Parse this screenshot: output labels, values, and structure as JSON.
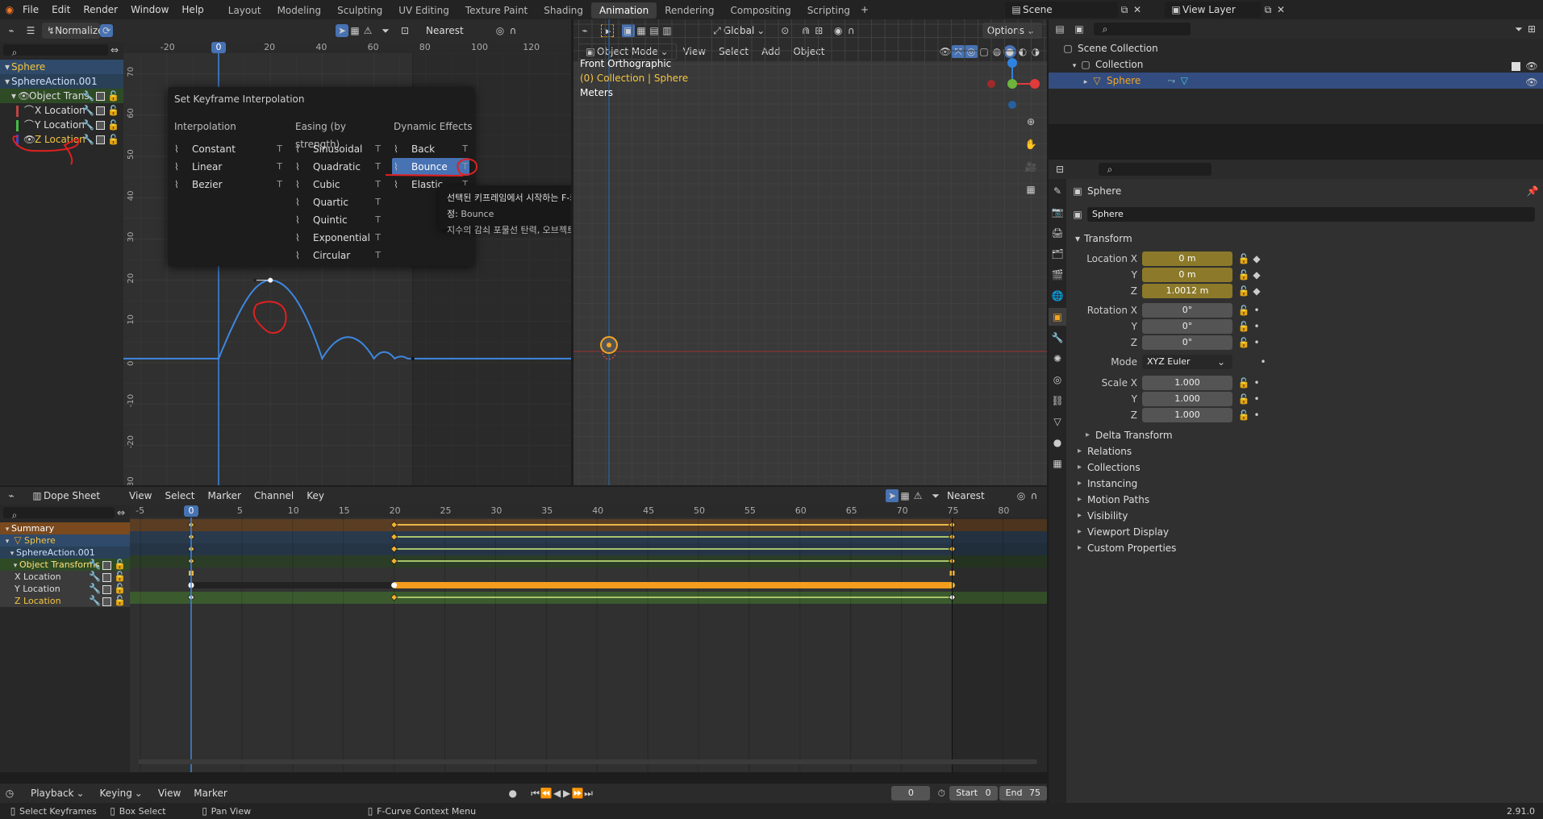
{
  "topbar": {
    "menus": [
      "File",
      "Edit",
      "Render",
      "Window",
      "Help"
    ],
    "workspaces": [
      "Layout",
      "Modeling",
      "Sculpting",
      "UV Editing",
      "Texture Paint",
      "Shading",
      "Animation",
      "Rendering",
      "Compositing",
      "Scripting"
    ],
    "active_workspace": "Animation",
    "scene": "Scene",
    "view_layer": "View Layer"
  },
  "graph": {
    "normalize": "Normalize",
    "snap": "Nearest Frame",
    "x_ticks": [
      "-20",
      "0",
      "20",
      "40",
      "60",
      "80",
      "100",
      "120"
    ],
    "y_ticks": [
      "70",
      "60",
      "50",
      "40",
      "30",
      "20",
      "10",
      "0",
      "-10",
      "-20",
      "-30"
    ],
    "current_frame": "0",
    "channels": [
      {
        "label": "Sphere"
      },
      {
        "label": "SphereAction.001"
      },
      {
        "label": "Object Trans"
      },
      {
        "label": "X Location"
      },
      {
        "label": "Y Location"
      },
      {
        "label": "Z Location"
      }
    ]
  },
  "popup": {
    "title": "Set Keyframe Interpolation",
    "col1": {
      "header": "Interpolation",
      "items": [
        {
          "label": "Constant",
          "sc": "T"
        },
        {
          "label": "Linear",
          "sc": "T"
        },
        {
          "label": "Bezier",
          "sc": "T"
        }
      ]
    },
    "col2": {
      "header": "Easing (by strength)",
      "items": [
        {
          "label": "Sinusoidal",
          "sc": "T"
        },
        {
          "label": "Quadratic",
          "sc": "T"
        },
        {
          "label": "Cubic",
          "sc": "T"
        },
        {
          "label": "Quartic",
          "sc": "T"
        },
        {
          "label": "Quintic",
          "sc": "T"
        },
        {
          "label": "Exponential",
          "sc": "T"
        },
        {
          "label": "Circular",
          "sc": "T"
        }
      ]
    },
    "col3": {
      "header": "Dynamic Effects",
      "items": [
        {
          "label": "Back",
          "sc": "T"
        },
        {
          "label": "Bounce",
          "sc": "T"
        },
        {
          "label": "Elastic",
          "sc": "T"
        }
      ]
    },
    "tooltip_line1": "선택된 키프레임에서 시작하는 F-커브 부분에 대한 보간 모드를 설정:",
    "tooltip_value": "Bounce",
    "tooltip_line2": "지수의 감쇠 포물선 탄력, 오브젝트가 충돌할 때 같은"
  },
  "viewport": {
    "mode": "Object Mode",
    "menus": [
      "View",
      "Select",
      "Add",
      "Object"
    ],
    "orientation": "Global",
    "options": "Options",
    "overlay1": "Front Orthographic",
    "overlay2": "(0) Collection | Sphere",
    "overlay3": "Meters"
  },
  "outliner": {
    "items": [
      {
        "label": "Scene Collection"
      },
      {
        "label": "Collection"
      },
      {
        "label": "Sphere"
      }
    ]
  },
  "properties": {
    "object_name": "Sphere",
    "data_name": "Sphere",
    "transform": "Transform",
    "loc": [
      {
        "l": "Location X",
        "v": "0 m"
      },
      {
        "l": "Y",
        "v": "0 m"
      },
      {
        "l": "Z",
        "v": "1.0012 m"
      }
    ],
    "rot": [
      {
        "l": "Rotation X",
        "v": "0°"
      },
      {
        "l": "Y",
        "v": "0°"
      },
      {
        "l": "Z",
        "v": "0°"
      }
    ],
    "mode_label": "Mode",
    "mode_value": "XYZ Euler",
    "scale": [
      {
        "l": "Scale X",
        "v": "1.000"
      },
      {
        "l": "Y",
        "v": "1.000"
      },
      {
        "l": "Z",
        "v": "1.000"
      }
    ],
    "delta": "Delta Transform",
    "sections": [
      "Relations",
      "Collections",
      "Instancing",
      "Motion Paths",
      "Visibility",
      "Viewport Display",
      "Custom Properties"
    ]
  },
  "dope": {
    "editor": "Dope Sheet",
    "menus": [
      "View",
      "Select",
      "Marker",
      "Channel",
      "Key"
    ],
    "snap": "Nearest Frame",
    "ticks": [
      "-5",
      "0",
      "5",
      "10",
      "15",
      "20",
      "25",
      "30",
      "35",
      "40",
      "45",
      "50",
      "55",
      "60",
      "65",
      "70",
      "75",
      "80"
    ],
    "current": "0",
    "channels": [
      {
        "label": "Summary"
      },
      {
        "label": "Sphere"
      },
      {
        "label": "SphereAction.001"
      },
      {
        "label": "Object Transforms"
      },
      {
        "label": "X Location"
      },
      {
        "label": "Y Location"
      },
      {
        "label": "Z Location"
      }
    ]
  },
  "timeline": {
    "menus": [
      "Playback",
      "Keying",
      "View",
      "Marker"
    ],
    "frame": "0",
    "start_label": "Start",
    "start": "0",
    "end_label": "End",
    "end": "75"
  },
  "status": {
    "items": [
      "Select Keyframes",
      "Box Select",
      "Pan View",
      "F-Curve Context Menu"
    ],
    "version": "2.91.0"
  }
}
